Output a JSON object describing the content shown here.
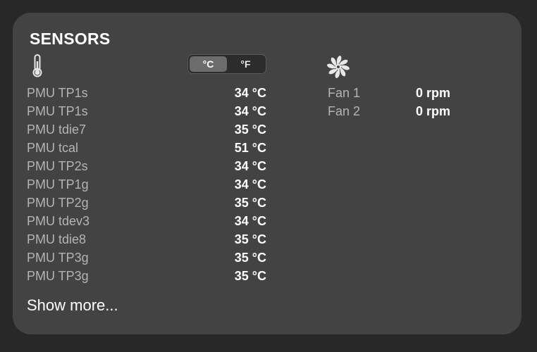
{
  "panel": {
    "title": "SENSORS",
    "temperature_icon": "thermometer-icon",
    "fan_icon": "fan-icon"
  },
  "unit_toggle": {
    "celsius_label": "°C",
    "fahrenheit_label": "°F",
    "selected": "°C"
  },
  "sensors": [
    {
      "label": "PMU TP1s",
      "value": "34 °C"
    },
    {
      "label": "PMU TP1s",
      "value": "34 °C"
    },
    {
      "label": "PMU tdie7",
      "value": "35 °C"
    },
    {
      "label": "PMU tcal",
      "value": "51 °C"
    },
    {
      "label": "PMU TP2s",
      "value": "34 °C"
    },
    {
      "label": "PMU TP1g",
      "value": "34 °C"
    },
    {
      "label": "PMU TP2g",
      "value": "35 °C"
    },
    {
      "label": "PMU tdev3",
      "value": "34 °C"
    },
    {
      "label": "PMU tdie8",
      "value": "35 °C"
    },
    {
      "label": "PMU TP3g",
      "value": "35 °C"
    },
    {
      "label": "PMU TP3g",
      "value": "35 °C"
    }
  ],
  "fans": [
    {
      "label": "Fan 1",
      "value": "0 rpm"
    },
    {
      "label": "Fan 2",
      "value": "0 rpm"
    }
  ],
  "show_more_label": "Show more...",
  "colors": {
    "background": "#282828",
    "card": "#434343",
    "label": "#b4b4b4",
    "value": "#ffffff",
    "toggle_active": "#6c6c6c"
  }
}
